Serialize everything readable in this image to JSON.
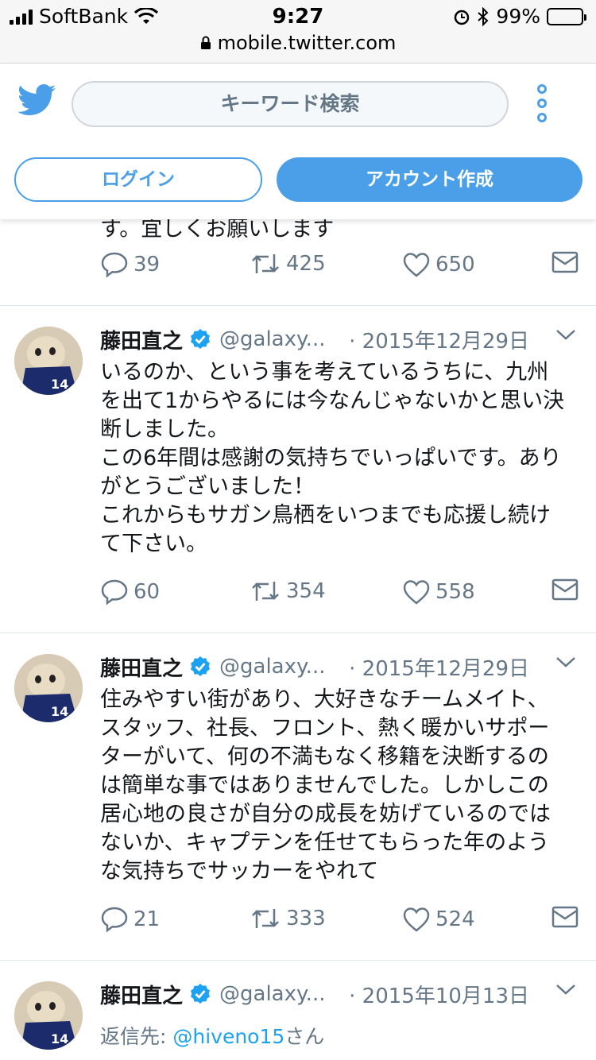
{
  "status_bar": {
    "carrier": "SoftBank",
    "time": "9:27",
    "battery": "99%",
    "battery_level": 0.99,
    "url": "mobile.twitter.com"
  },
  "header": {
    "search_placeholder": "キーワード検索",
    "login_label": "ログイン",
    "signup_label": "アカウント作成",
    "brand_color": "#4a9fe8"
  },
  "partial_tweet": {
    "text": "す。宜しくお願いします",
    "replies": "39",
    "retweets": "425",
    "likes": "650"
  },
  "tweets": [
    {
      "name": "藤田直之",
      "handle": "@galaxy...",
      "date": "· 2015年12月29日",
      "lines": [
        "いるのか、という事を考えているうちに、九州",
        "を出て1からやるには今なんじゃないかと思い決",
        "断しました。",
        "この6年間は感謝の気持ちでいっぱいです。あり",
        "がとうございました！",
        "これからもサガン鳥栖をいつまでも応援し続け",
        "て下さい。"
      ],
      "replies": "60",
      "retweets": "354",
      "likes": "558"
    },
    {
      "name": "藤田直之",
      "handle": "@galaxy...",
      "date": "· 2015年12月29日",
      "lines": [
        "住みやすい街があり、大好きなチームメイト、",
        "スタッフ、社長、フロント、熱く暖かいサポー",
        "ターがいて、何の不満もなく移籍を決断するの",
        "は簡単な事ではありませんでした。しかしこの",
        "居心地の良さが自分の成長を妨げているのでは",
        "ないか、キャプテンを任せてもらった年のよう",
        "な気持ちでサッカーをやれて"
      ],
      "replies": "21",
      "retweets": "333",
      "likes": "524"
    },
    {
      "name": "藤田直之",
      "handle": "@galaxy...",
      "date": "· 2015年10月13日",
      "reply_prefix": "返信先: ",
      "reply_user": "@hiveno15",
      "reply_suffix": "さん"
    }
  ]
}
